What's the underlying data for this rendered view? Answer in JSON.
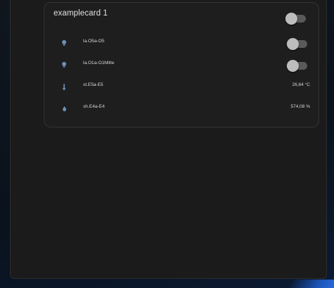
{
  "card": {
    "title": "examplecard 1",
    "header_toggle": {
      "state": "off"
    },
    "rows": [
      {
        "label": "la.O5a-O5",
        "icon": "lightbulb-icon",
        "control": "toggle",
        "state": "off"
      },
      {
        "label": "la.O1a-O1Mitte",
        "icon": "lightbulb-icon",
        "control": "toggle",
        "state": "off"
      },
      {
        "label": "st.E5a-E5",
        "icon": "thermometer-icon",
        "control": "value",
        "value": "26,64 °C"
      },
      {
        "label": "sh.E4a-E4",
        "icon": "water-drop-icon",
        "control": "value",
        "value": "574,08 %"
      }
    ]
  },
  "colors": {
    "icon": "#6e8fb8",
    "toggle_track": "#5a5a5a",
    "toggle_knob": "#bdbdbd",
    "card_background": "#1e1e1e"
  }
}
